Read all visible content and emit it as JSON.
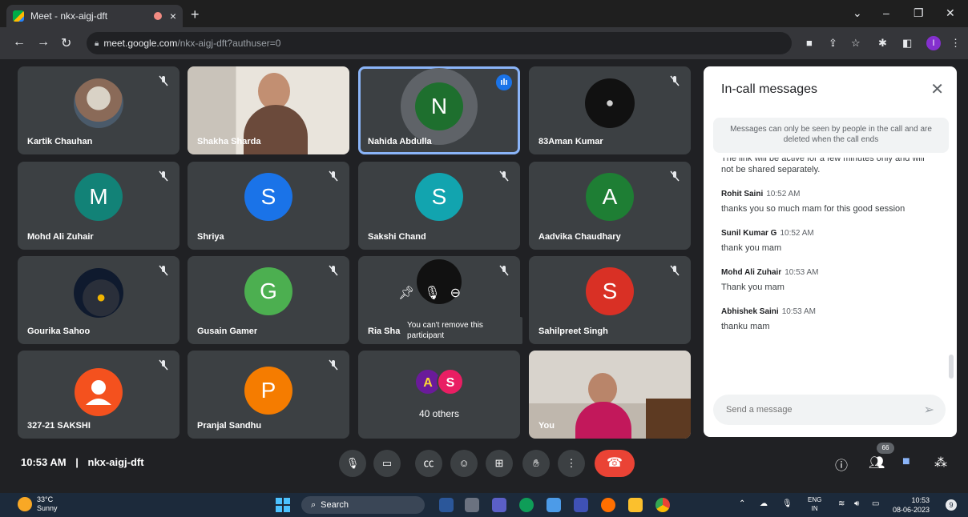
{
  "browser": {
    "tab_title": "Meet - nkx-aigj-dft",
    "new_tab": "+",
    "close_tab": "×",
    "url_domain": "meet.google.com",
    "url_path": "/nkx-aigj-dft?authuser=0",
    "profile_initial": "I",
    "win_min": "–",
    "win_restore": "❐",
    "win_close": "✕",
    "win_dropdown": "⌄"
  },
  "tiles": [
    {
      "name": "Kartik Chauhan",
      "type": "photo",
      "muted": true
    },
    {
      "name": "Shakha Sharda",
      "type": "video",
      "muted": false
    },
    {
      "name": "Nahida Abdulla",
      "type": "avatar",
      "initial": "N",
      "color": "#1e6f2e",
      "speaking": true
    },
    {
      "name": "83Aman Kumar",
      "type": "photo",
      "muted": true
    },
    {
      "name": "Mohd Ali Zuhair",
      "type": "avatar",
      "initial": "M",
      "color": "#128277",
      "muted": true
    },
    {
      "name": "Shriya",
      "type": "avatar",
      "initial": "S",
      "color": "#1a73e8",
      "muted": true
    },
    {
      "name": "Sakshi Chand",
      "type": "avatar",
      "initial": "S",
      "color": "#12a4af",
      "muted": true
    },
    {
      "name": "Aadvika Chaudhary",
      "type": "avatar",
      "initial": "A",
      "color": "#1e7e34",
      "muted": true
    },
    {
      "name": "Gourika Sahoo",
      "type": "photo",
      "muted": true
    },
    {
      "name": "Gusain Gamer",
      "type": "avatar",
      "initial": "G",
      "color": "#4caf50",
      "muted": true
    },
    {
      "name": "Ria Sha",
      "type": "hover",
      "muted": true
    },
    {
      "name": "Sahilpreet Singh",
      "type": "avatar",
      "initial": "S",
      "color": "#d93025",
      "muted": true
    },
    {
      "name": "327-21 SAKSHI",
      "type": "default",
      "muted": true
    },
    {
      "name": "Pranjal Sandhu",
      "type": "avatar",
      "initial": "P",
      "color": "#f57c00",
      "muted": true
    },
    {
      "name": "",
      "type": "others",
      "label": "40 others",
      "initials": [
        "A",
        "S"
      ]
    },
    {
      "name": "You",
      "type": "video-self",
      "muted": false
    }
  ],
  "tooltip": "You can't remove this participant",
  "chat": {
    "title": "In-call messages",
    "notice": "Messages can only be seen by people in the call and are deleted when the call ends",
    "partial": "The link will be active for a few minutes only and will not be shared separately.",
    "messages": [
      {
        "sender": "Rohit Saini",
        "time": "10:52 AM",
        "text": "thanks you so much mam for this good session"
      },
      {
        "sender": "Sunil Kumar G",
        "time": "10:52 AM",
        "text": "thank you mam"
      },
      {
        "sender": "Mohd Ali Zuhair",
        "time": "10:53 AM",
        "text": "Thank you mam"
      },
      {
        "sender": "Abhishek Saini",
        "time": "10:53 AM",
        "text": "thanku mam"
      }
    ],
    "input_placeholder": "Send a message"
  },
  "meeting": {
    "time": "10:53 AM",
    "separator": "|",
    "code": "nkx-aigj-dft",
    "participants_count": "66"
  },
  "taskbar": {
    "temp": "33°C",
    "condition": "Sunny",
    "search": "Search",
    "lang": "ENG",
    "region": "IN",
    "time": "10:53",
    "date": "08-06-2023",
    "notif": "9"
  }
}
